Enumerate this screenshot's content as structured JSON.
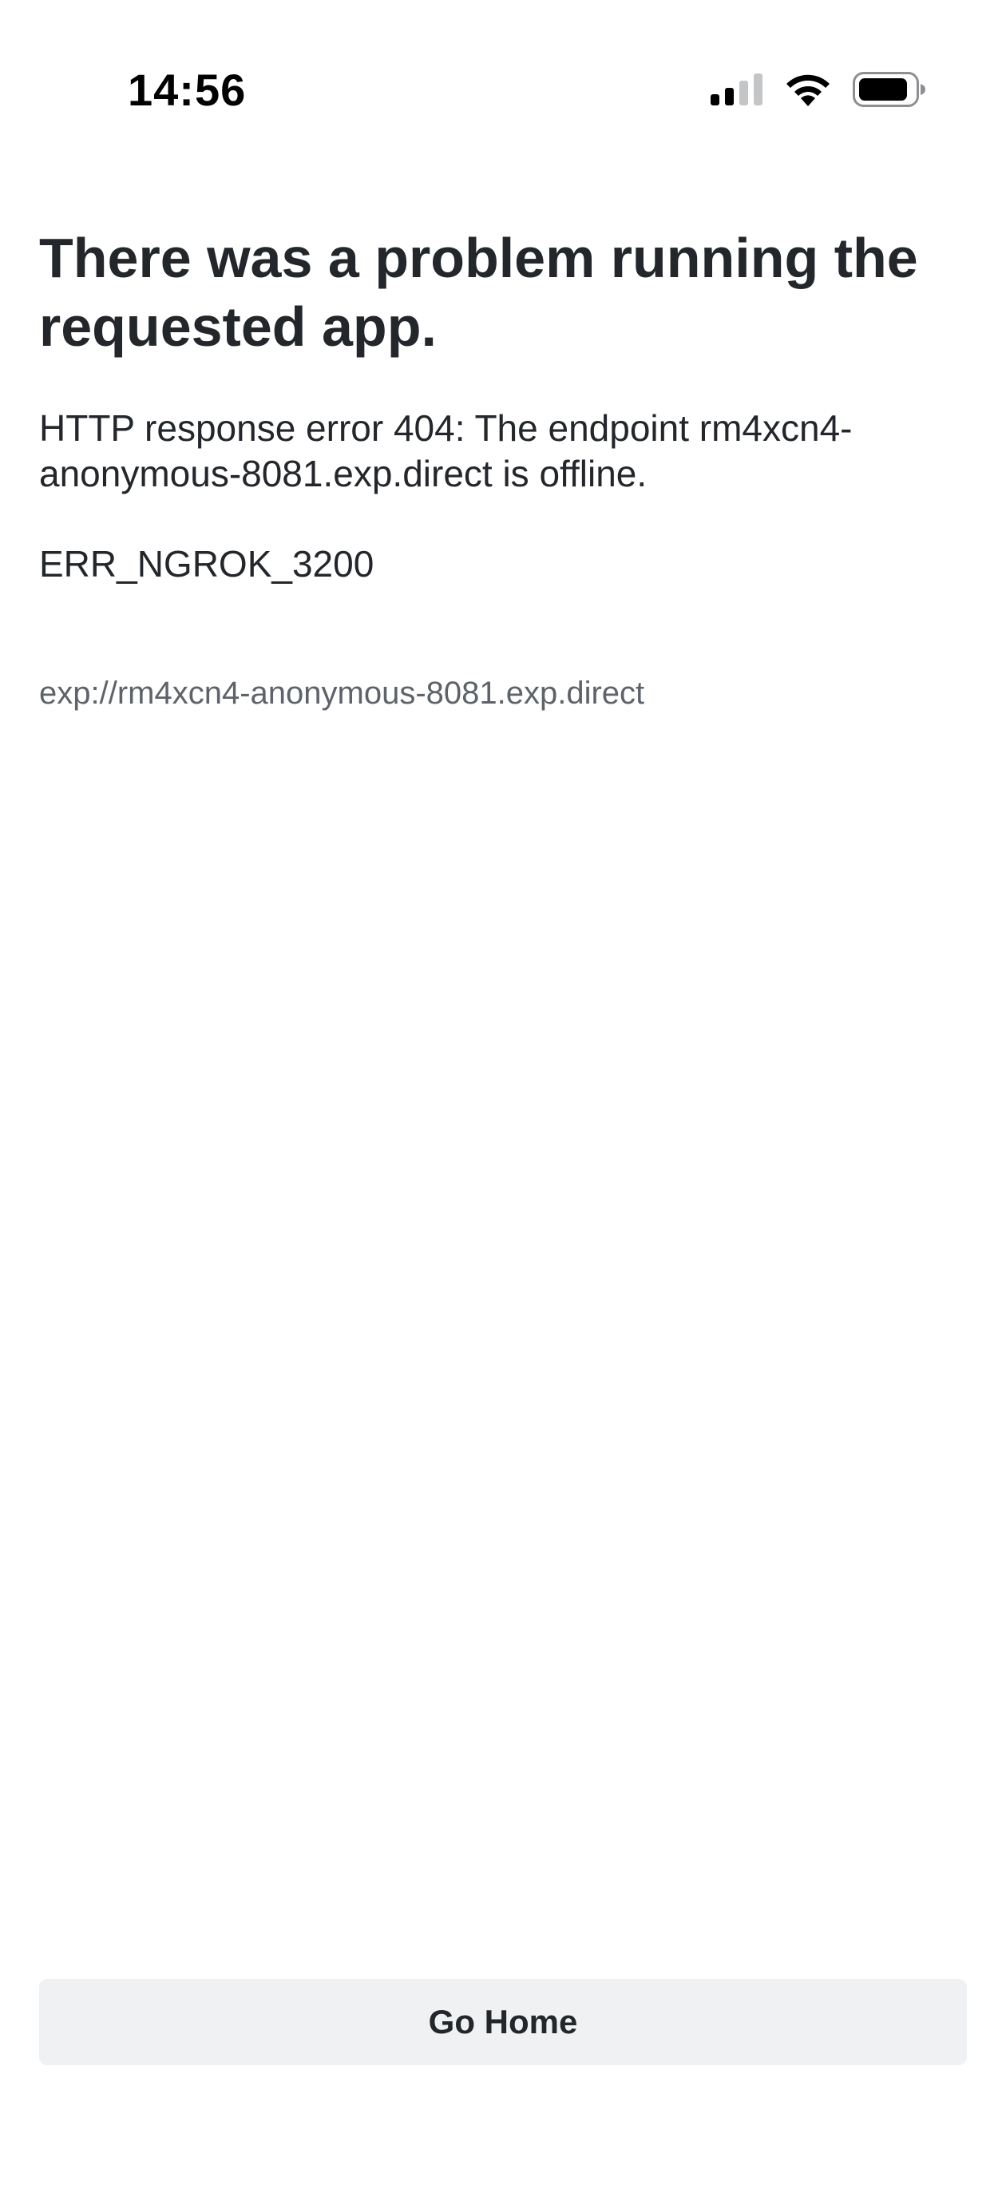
{
  "status_bar": {
    "time": "14:56",
    "icons": [
      "signal-icon",
      "wifi-icon",
      "battery-icon"
    ]
  },
  "error": {
    "title": "There was a problem running the requested app.",
    "message": "HTTP response error 404: The endpoint rm4xcn4-anonymous-8081.exp.direct is offline.",
    "code": "ERR_NGROK_3200",
    "url": "exp://rm4xcn4-anonymous-8081.exp.direct"
  },
  "actions": {
    "go_home_label": "Go Home"
  },
  "colors": {
    "text": "#23262b",
    "muted_text": "#5e636b",
    "button_bg": "#f0f1f2",
    "background": "#ffffff"
  }
}
